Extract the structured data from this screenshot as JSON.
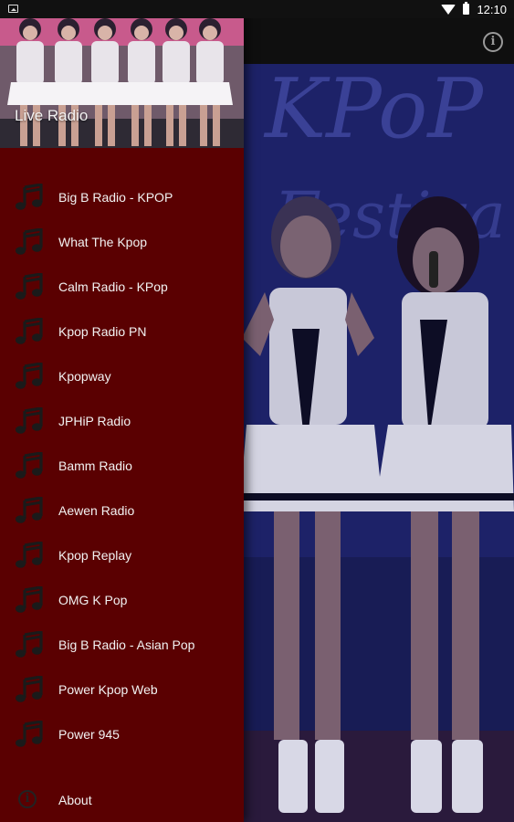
{
  "status_bar": {
    "time": "12:10",
    "icons": [
      "image-notification-icon",
      "wifi-icon",
      "battery-icon"
    ]
  },
  "toolbar": {
    "info_icon": "info-icon",
    "info_glyph": "i"
  },
  "drawer": {
    "header_title": "Live Radio",
    "item_icon": "music-note-icon",
    "items": [
      {
        "label": "Big B Radio - KPOP"
      },
      {
        "label": "What The Kpop"
      },
      {
        "label": "Calm Radio - KPop"
      },
      {
        "label": "Kpop Radio PN"
      },
      {
        "label": "Kpopway"
      },
      {
        "label": "JPHiP Radio"
      },
      {
        "label": "Bamm Radio"
      },
      {
        "label": "Aewen Radio"
      },
      {
        "label": "Kpop Replay"
      },
      {
        "label": "OMG K Pop"
      },
      {
        "label": "Big B Radio - Asian Pop"
      },
      {
        "label": "Power Kpop Web"
      },
      {
        "label": "Power 945"
      }
    ],
    "about": {
      "label": "About",
      "icon": "info-icon",
      "glyph": "i"
    }
  },
  "colors": {
    "drawer_bg": "#5a0001",
    "toolbar_bg": "#0f0f0f",
    "text": "#f2f2f2",
    "icon_dark": "#1a1a1a"
  }
}
